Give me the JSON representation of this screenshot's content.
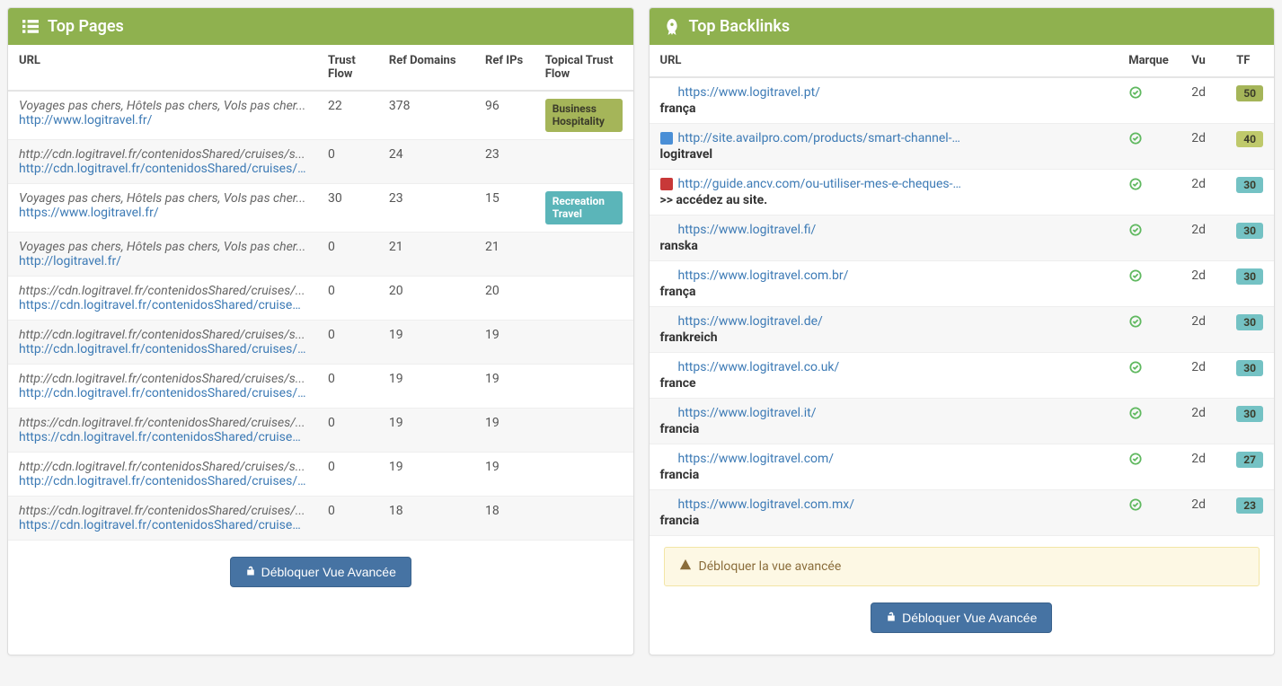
{
  "pages_panel": {
    "title": "Top Pages",
    "unlock_label": "Débloquer Vue Avancée",
    "columns": {
      "url": "URL",
      "trust_flow": "Trust Flow",
      "ref_domains": "Ref Domains",
      "ref_ips": "Ref IPs",
      "topical": "Topical Trust Flow"
    },
    "rows": [
      {
        "title": "Voyages pas chers, Hôtels pas chers, Vols pas cher...",
        "url": "http://www.logitravel.fr/",
        "trust_flow": "22",
        "ref_domains": "378",
        "ref_ips": "96",
        "topic_label": "Business Hospitality",
        "topic_class": "badge-business"
      },
      {
        "title": "http://cdn.logitravel.fr/contenidosShared/cruises/s...",
        "url": "http://cdn.logitravel.fr/contenidosShared/cruises/s...",
        "trust_flow": "0",
        "ref_domains": "24",
        "ref_ips": "23",
        "topic_label": "",
        "topic_class": ""
      },
      {
        "title": "Voyages pas chers, Hôtels pas chers, Vols pas cher...",
        "url": "https://www.logitravel.fr/",
        "trust_flow": "30",
        "ref_domains": "23",
        "ref_ips": "15",
        "topic_label": "Recreation Travel",
        "topic_class": "badge-recreation"
      },
      {
        "title": "Voyages pas chers, Hôtels pas chers, Vols pas cher...",
        "url": "http://logitravel.fr/",
        "trust_flow": "0",
        "ref_domains": "21",
        "ref_ips": "21",
        "topic_label": "",
        "topic_class": ""
      },
      {
        "title": "https://cdn.logitravel.fr/contenidosShared/cruises/...",
        "url": "https://cdn.logitravel.fr/contenidosShared/cruises/...",
        "trust_flow": "0",
        "ref_domains": "20",
        "ref_ips": "20",
        "topic_label": "",
        "topic_class": ""
      },
      {
        "title": "http://cdn.logitravel.fr/contenidosShared/cruises/s...",
        "url": "http://cdn.logitravel.fr/contenidosShared/cruises/s...",
        "trust_flow": "0",
        "ref_domains": "19",
        "ref_ips": "19",
        "topic_label": "",
        "topic_class": ""
      },
      {
        "title": "http://cdn.logitravel.fr/contenidosShared/cruises/s...",
        "url": "http://cdn.logitravel.fr/contenidosShared/cruises/s...",
        "trust_flow": "0",
        "ref_domains": "19",
        "ref_ips": "19",
        "topic_label": "",
        "topic_class": ""
      },
      {
        "title": "https://cdn.logitravel.fr/contenidosShared/cruises/...",
        "url": "https://cdn.logitravel.fr/contenidosShared/cruises/...",
        "trust_flow": "0",
        "ref_domains": "19",
        "ref_ips": "19",
        "topic_label": "",
        "topic_class": ""
      },
      {
        "title": "http://cdn.logitravel.fr/contenidosShared/cruises/s...",
        "url": "http://cdn.logitravel.fr/contenidosShared/cruises/s...",
        "trust_flow": "0",
        "ref_domains": "19",
        "ref_ips": "19",
        "topic_label": "",
        "topic_class": ""
      },
      {
        "title": "https://cdn.logitravel.fr/contenidosShared/cruises/...",
        "url": "https://cdn.logitravel.fr/contenidosShared/cruises/...",
        "trust_flow": "0",
        "ref_domains": "18",
        "ref_ips": "18",
        "topic_label": "",
        "topic_class": ""
      }
    ]
  },
  "backlinks_panel": {
    "title": "Top Backlinks",
    "unlock_label": "Débloquer Vue Avancée",
    "warning_text": "Débloquer la vue avancée",
    "columns": {
      "url": "URL",
      "marque": "Marque",
      "vu": "Vu",
      "tf": "TF"
    },
    "rows": [
      {
        "url": "https://www.logitravel.pt/",
        "anchor": "frança",
        "vu": "2d",
        "tf": "50",
        "tf_class": "tf-50",
        "favicon_color": ""
      },
      {
        "url": "http://site.availpro.com/products/smart-channel-manager/",
        "anchor": "logitravel",
        "vu": "2d",
        "tf": "40",
        "tf_class": "tf-40",
        "favicon_color": "#4a8fd6"
      },
      {
        "url": "http://guide.ancv.com/ou-utiliser-mes-e-cheques-vacances/",
        "anchor": ">> accédez au site.",
        "vu": "2d",
        "tf": "30",
        "tf_class": "tf-30",
        "favicon_color": "#c83838"
      },
      {
        "url": "https://www.logitravel.fi/",
        "anchor": "ranska",
        "vu": "2d",
        "tf": "30",
        "tf_class": "tf-30",
        "favicon_color": ""
      },
      {
        "url": "https://www.logitravel.com.br/",
        "anchor": "frança",
        "vu": "2d",
        "tf": "30",
        "tf_class": "tf-30",
        "favicon_color": ""
      },
      {
        "url": "https://www.logitravel.de/",
        "anchor": "frankreich",
        "vu": "2d",
        "tf": "30",
        "tf_class": "tf-30",
        "favicon_color": ""
      },
      {
        "url": "https://www.logitravel.co.uk/",
        "anchor": "france",
        "vu": "2d",
        "tf": "30",
        "tf_class": "tf-30",
        "favicon_color": ""
      },
      {
        "url": "https://www.logitravel.it/",
        "anchor": "francia",
        "vu": "2d",
        "tf": "30",
        "tf_class": "tf-30",
        "favicon_color": ""
      },
      {
        "url": "https://www.logitravel.com/",
        "anchor": "francia",
        "vu": "2d",
        "tf": "27",
        "tf_class": "tf-27",
        "favicon_color": ""
      },
      {
        "url": "https://www.logitravel.com.mx/",
        "anchor": "francia",
        "vu": "2d",
        "tf": "23",
        "tf_class": "tf-23",
        "favicon_color": ""
      }
    ]
  }
}
